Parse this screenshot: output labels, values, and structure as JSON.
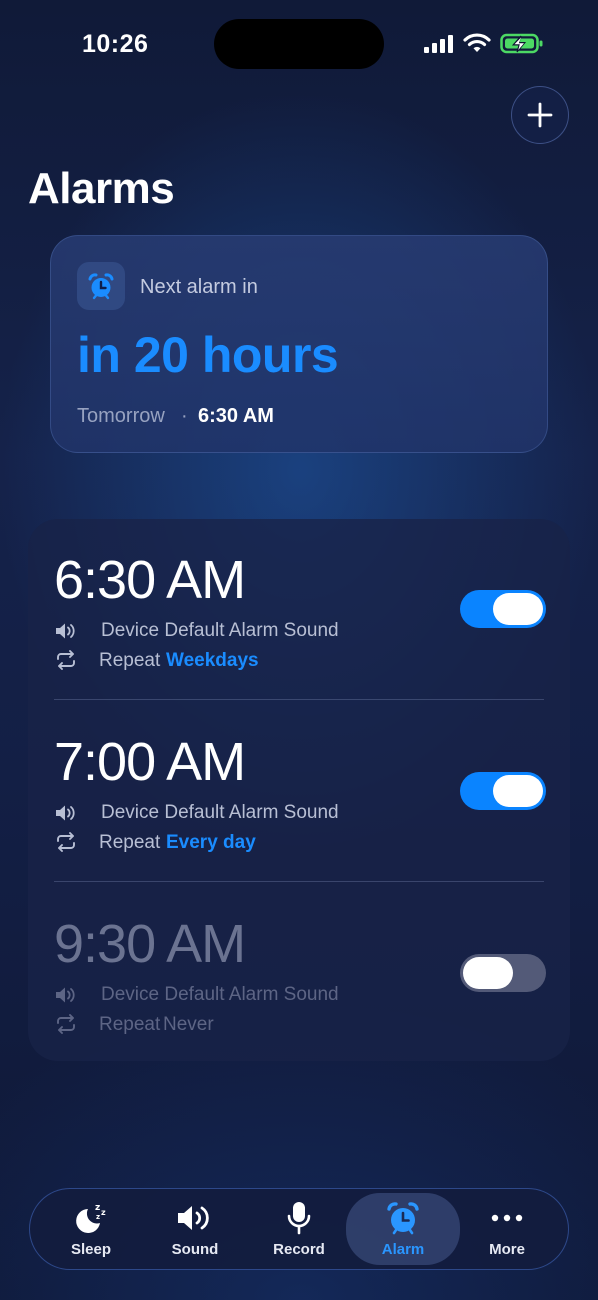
{
  "status_bar": {
    "time": "10:26"
  },
  "header": {
    "title": "Alarms",
    "add_icon": "plus-icon"
  },
  "next_alarm": {
    "label": "Next alarm in",
    "countdown": "in 20 hours",
    "day": "Tomorrow",
    "separator": "·",
    "time": "6:30 AM",
    "icon": "alarm-clock-icon"
  },
  "alarms": [
    {
      "time": "6:30 AM",
      "sound": "Device Default Alarm Sound",
      "repeat_label": "Repeat",
      "repeat_value": "Weekdays",
      "enabled": true
    },
    {
      "time": "7:00 AM",
      "sound": "Device Default Alarm Sound",
      "repeat_label": "Repeat",
      "repeat_value": "Every day",
      "enabled": true
    },
    {
      "time": "9:30 AM",
      "sound": "Device Default Alarm Sound",
      "repeat_label": "Repeat",
      "repeat_value": "Never",
      "enabled": false
    }
  ],
  "tabs": [
    {
      "label": "Sleep",
      "icon": "moon-icon",
      "active": false
    },
    {
      "label": "Sound",
      "icon": "speaker-icon",
      "active": false
    },
    {
      "label": "Record",
      "icon": "microphone-icon",
      "active": false
    },
    {
      "label": "Alarm",
      "icon": "alarm-clock-icon",
      "active": true
    },
    {
      "label": "More",
      "icon": "more-dots-icon",
      "active": false
    }
  ],
  "colors": {
    "accent": "#1a8cff",
    "toggle_on": "#0a84ff",
    "toggle_off": "#535a78",
    "battery_charging": "#4cd964"
  }
}
